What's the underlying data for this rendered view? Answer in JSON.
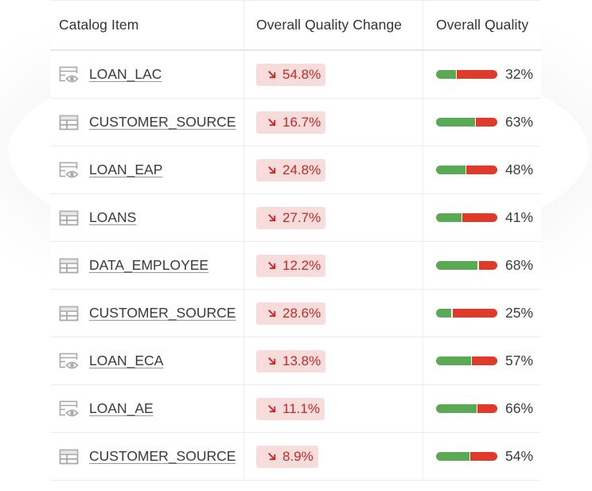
{
  "table": {
    "headers": {
      "catalog_item": "Catalog Item",
      "quality_change": "Overall Quality Change",
      "overall_quality": "Overall Quality"
    },
    "colors": {
      "good": "#5aaa55",
      "bad": "#e03a2a",
      "change_text": "#c62828",
      "change_bg": "#f7dcdc"
    },
    "rows": [
      {
        "icon": "view-icon",
        "name": "LOAN_LAC",
        "change": "54.8%",
        "direction": "down",
        "quality": "32%",
        "quality_value": 32
      },
      {
        "icon": "table-icon",
        "name": "CUSTOMER_SOURCE",
        "change": "16.7%",
        "direction": "down",
        "quality": "63%",
        "quality_value": 63
      },
      {
        "icon": "view-icon",
        "name": "LOAN_EAP",
        "change": "24.8%",
        "direction": "down",
        "quality": "48%",
        "quality_value": 48
      },
      {
        "icon": "table-icon",
        "name": "LOANS",
        "change": "27.7%",
        "direction": "down",
        "quality": "41%",
        "quality_value": 41
      },
      {
        "icon": "table-icon",
        "name": "DATA_EMPLOYEE",
        "change": "12.2%",
        "direction": "down",
        "quality": "68%",
        "quality_value": 68
      },
      {
        "icon": "table-icon",
        "name": "CUSTOMER_SOURCE",
        "change": "28.6%",
        "direction": "down",
        "quality": "25%",
        "quality_value": 25
      },
      {
        "icon": "view-icon",
        "name": "LOAN_ECA",
        "change": "13.8%",
        "direction": "down",
        "quality": "57%",
        "quality_value": 57
      },
      {
        "icon": "view-icon",
        "name": "LOAN_AE",
        "change": "11.1%",
        "direction": "down",
        "quality": "66%",
        "quality_value": 66
      },
      {
        "icon": "table-icon",
        "name": "CUSTOMER_SOURCE",
        "change": "8.9%",
        "direction": "down",
        "quality": "54%",
        "quality_value": 54
      }
    ]
  }
}
